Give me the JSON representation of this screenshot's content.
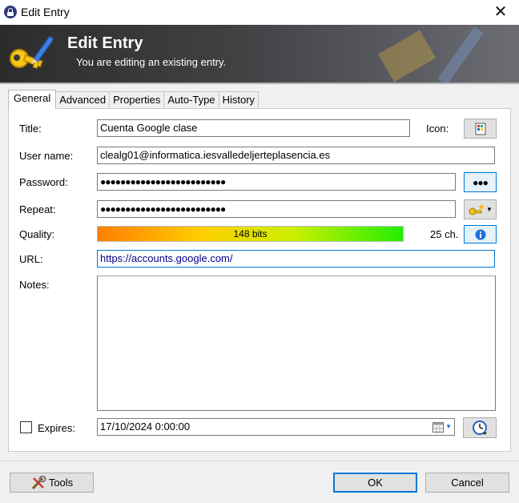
{
  "window": {
    "title": "Edit Entry"
  },
  "banner": {
    "title": "Edit Entry",
    "subtitle": "You are editing an existing entry."
  },
  "tabs": [
    {
      "label": "General",
      "active": true
    },
    {
      "label": "Advanced"
    },
    {
      "label": "Properties"
    },
    {
      "label": "Auto-Type"
    },
    {
      "label": "History"
    }
  ],
  "form": {
    "title_label": "Title:",
    "title_value": "Cuenta Google clase",
    "icon_label": "Icon:",
    "username_label": "User name:",
    "username_value": "clealg01@informatica.iesvalledeljerteplasencia.es",
    "password_label": "Password:",
    "password_value": "●●●●●●●●●●●●●●●●●●●●●●●●●",
    "repeat_label": "Repeat:",
    "repeat_value": "●●●●●●●●●●●●●●●●●●●●●●●●●",
    "show_password_label": "●●●",
    "quality_label": "Quality:",
    "quality_text": "148 bits",
    "quality_fraction": 1.0,
    "char_count": "25 ch.",
    "url_label": "URL:",
    "url_value": "https://accounts.google.com/",
    "notes_label": "Notes:",
    "notes_value": "",
    "expires_label": "Expires:",
    "expires_checked": false,
    "expires_value": "17/10/2024   0:00:00"
  },
  "footer": {
    "tools_label": "Tools",
    "ok_label": "OK",
    "cancel_label": "Cancel"
  },
  "colors": {
    "accent": "#0078d7",
    "banner_dark": "#2c2c2c",
    "link_text": "#00008b"
  },
  "icons": [
    "lock-icon",
    "close-icon",
    "key-pen-icon",
    "entry-icon",
    "generate-password-icon",
    "info-icon",
    "calendar-icon",
    "clock-icon",
    "tools-icon"
  ]
}
